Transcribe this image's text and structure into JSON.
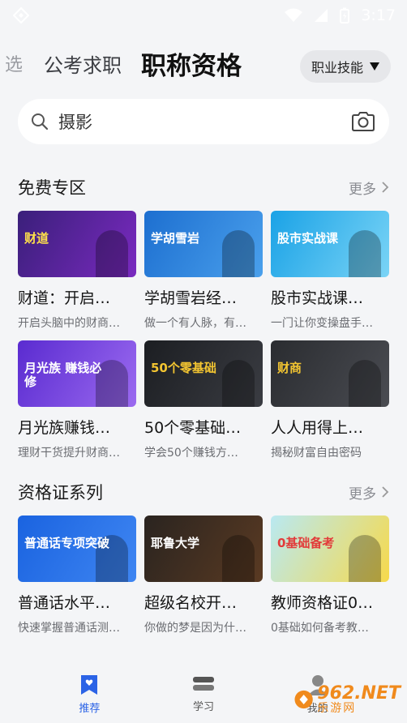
{
  "status": {
    "time": "3:17"
  },
  "tabs": {
    "faded": "选",
    "items": [
      "公考求职",
      "职称资格"
    ],
    "active_index": 1
  },
  "dropdown": {
    "label": "职业技能"
  },
  "search": {
    "value": "摄影"
  },
  "sections": [
    {
      "title": "免费专区",
      "more": "更多",
      "cards": [
        {
          "title": "财道：开启…",
          "sub": "开启头脑中的财商…",
          "thumb": {
            "text": "财道",
            "bg": "#3a1f7a",
            "bg2": "#7a2ac0",
            "fg": "#ffe14a"
          }
        },
        {
          "title": "学胡雪岩经…",
          "sub": "做一个有人脉，有…",
          "thumb": {
            "text": "学胡雪岩",
            "bg": "#1d6fd0",
            "bg2": "#4aa0ec",
            "fg": "#ffffff"
          }
        },
        {
          "title": "股市实战课…",
          "sub": "一门让你变操盘手…",
          "thumb": {
            "text": "股市实战课",
            "bg": "#1aa2e6",
            "bg2": "#7ad4f6",
            "fg": "#ffffff"
          }
        },
        {
          "title": "月光族赚钱…",
          "sub": "理财干货提升财商…",
          "thumb": {
            "text": "月光族 赚钱必修",
            "bg": "#5a2bd0",
            "bg2": "#9b6af0",
            "fg": "#ffffff"
          }
        },
        {
          "title": "50个零基础…",
          "sub": "学会50个赚钱方…",
          "thumb": {
            "text": "50个零基础",
            "bg": "#1c1e22",
            "bg2": "#3a3c42",
            "fg": "#f3c531"
          }
        },
        {
          "title": "人人用得上…",
          "sub": "揭秘财富自由密码",
          "thumb": {
            "text": "财商",
            "bg": "#2a2c30",
            "bg2": "#4a4c52",
            "fg": "#f3c531"
          }
        }
      ]
    },
    {
      "title": "资格证系列",
      "more": "更多",
      "cards": [
        {
          "title": "普通话水平…",
          "sub": "快速掌握普通话测…",
          "thumb": {
            "text": "普通话专项突破",
            "bg": "#1a63e0",
            "bg2": "#3f86f2",
            "fg": "#ffffff"
          }
        },
        {
          "title": "超级名校开…",
          "sub": "你做的梦是因为什…",
          "thumb": {
            "text": "耶鲁大学",
            "bg": "#2a2420",
            "bg2": "#5a3a22",
            "fg": "#ffffff"
          }
        },
        {
          "title": "教师资格证0…",
          "sub": "0基础如何备考教…",
          "thumb": {
            "text": "0基础备考",
            "bg": "#b9e9f2",
            "bg2": "#f7d94a",
            "fg": "#e23a3a"
          }
        }
      ]
    }
  ],
  "nav": [
    {
      "label": "推荐",
      "icon": "bookmark-heart-icon"
    },
    {
      "label": "学习",
      "icon": "layers-icon"
    },
    {
      "label": "我的",
      "icon": "user-icon"
    }
  ],
  "watermark": {
    "text": "962.NET",
    "sub": "乐游网"
  },
  "colors": {
    "accent": "#2b63e6",
    "bg": "#f4f5f7"
  }
}
